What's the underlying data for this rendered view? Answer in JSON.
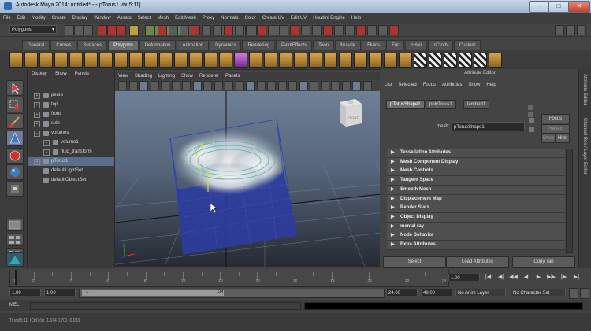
{
  "window": {
    "title": "Autodesk Maya 2014: untitled*   ---   pTorus1.vtx[5:11]",
    "minimize": "–",
    "maximize": "□",
    "close": "✕"
  },
  "menubar": [
    "File",
    "Edit",
    "Modify",
    "Create",
    "Display",
    "Window",
    "Assets",
    "Select",
    "Mesh",
    "Edit Mesh",
    "Proxy",
    "Normals",
    "Color",
    "Create UV",
    "Edit UV",
    "Houdini Engine",
    "Help"
  ],
  "statusline": {
    "mode": "Polygons"
  },
  "shelf_tabs": [
    "General",
    "Curves",
    "Surfaces",
    "Polygons",
    "Deformation",
    "Animation",
    "Dynamics",
    "Rendering",
    "PaintEffects",
    "Toon",
    "Muscle",
    "Fluids",
    "Fur",
    "nHair",
    "nCloth",
    "Custom"
  ],
  "shelf_active": "Polygons",
  "outliner": {
    "menu": [
      "Display",
      "Show",
      "Panels"
    ],
    "items": [
      {
        "label": "persp",
        "indent": 1,
        "expander": "+",
        "selected": false
      },
      {
        "label": "top",
        "indent": 1,
        "expander": "+",
        "selected": false
      },
      {
        "label": "front",
        "indent": 1,
        "expander": "+",
        "selected": false
      },
      {
        "label": "side",
        "indent": 1,
        "expander": "+",
        "selected": false
      },
      {
        "label": "volumes",
        "indent": 1,
        "expander": "–",
        "selected": false
      },
      {
        "label": "volume1",
        "indent": 2,
        "expander": "+",
        "selected": false
      },
      {
        "label": "fluid_transform",
        "indent": 2,
        "expander": "+",
        "selected": false
      },
      {
        "label": "pTorus1",
        "indent": 1,
        "expander": "+",
        "selected": true
      },
      {
        "label": "defaultLightSet",
        "indent": 1,
        "expander": "",
        "selected": false
      },
      {
        "label": "defaultObjectSet",
        "indent": 1,
        "expander": "",
        "selected": false
      }
    ]
  },
  "viewport": {
    "menu": [
      "View",
      "Shading",
      "Lighting",
      "Show",
      "Renderer",
      "Panels"
    ],
    "viewcube": {
      "top": "TOP",
      "front": "FRONT"
    },
    "axis": {
      "x": "x",
      "y": "y",
      "z": "z"
    }
  },
  "attribute_editor": {
    "title": "Attribute Editor",
    "menu": [
      "List",
      "Selected",
      "Focus",
      "Attributes",
      "Show",
      "Help"
    ],
    "tabs": [
      "pTorusShape1",
      "polyTorus1",
      "lambert1"
    ],
    "active_tab": "pTorusShape1",
    "mesh_label": "mesh:",
    "mesh_value": "pTorusShape1",
    "focus": "Focus",
    "presets": "Presets",
    "show": "Show",
    "hide": "Hide",
    "sections": [
      "Tessellation Attributes",
      "Mesh Component Display",
      "Mesh Controls",
      "Tangent Space",
      "Smooth Mesh",
      "Displacement Map",
      "Render Stats",
      "Object Display",
      "mental ray",
      "Node Behavior",
      "Extra Attributes"
    ],
    "buttons": [
      "Select",
      "Load Attributes",
      "Copy Tab"
    ]
  },
  "right_strip": [
    "Attribute Editor",
    "Channel Box / Layer Editor"
  ],
  "timeslider": {
    "ticks": [
      "1",
      "2",
      "4",
      "6",
      "8",
      "10",
      "12",
      "14",
      "16",
      "18",
      "20",
      "22",
      "24"
    ],
    "current": "1.00",
    "progress": 0.0
  },
  "playback": [
    "|◀",
    "◀|",
    "◀◀",
    "◀",
    "▶",
    "▶▶",
    "|▶",
    "▶|"
  ],
  "range": {
    "start": "1.00",
    "start_inner": "1.00",
    "range_left": "1",
    "range_right": "24",
    "end_inner": "24.00",
    "end": "48.00",
    "anim_layer": "No Anim Layer",
    "character_set": "No Character Set"
  },
  "mel_label": "MEL",
  "help_text": "Tr vtx[5:11] (Ctrl) (s)    -1.674    0.701    -0.083",
  "colors": {
    "selection": "#5a6e8c",
    "accent": "#3d7ac0",
    "brand": "#2a6fb0"
  }
}
